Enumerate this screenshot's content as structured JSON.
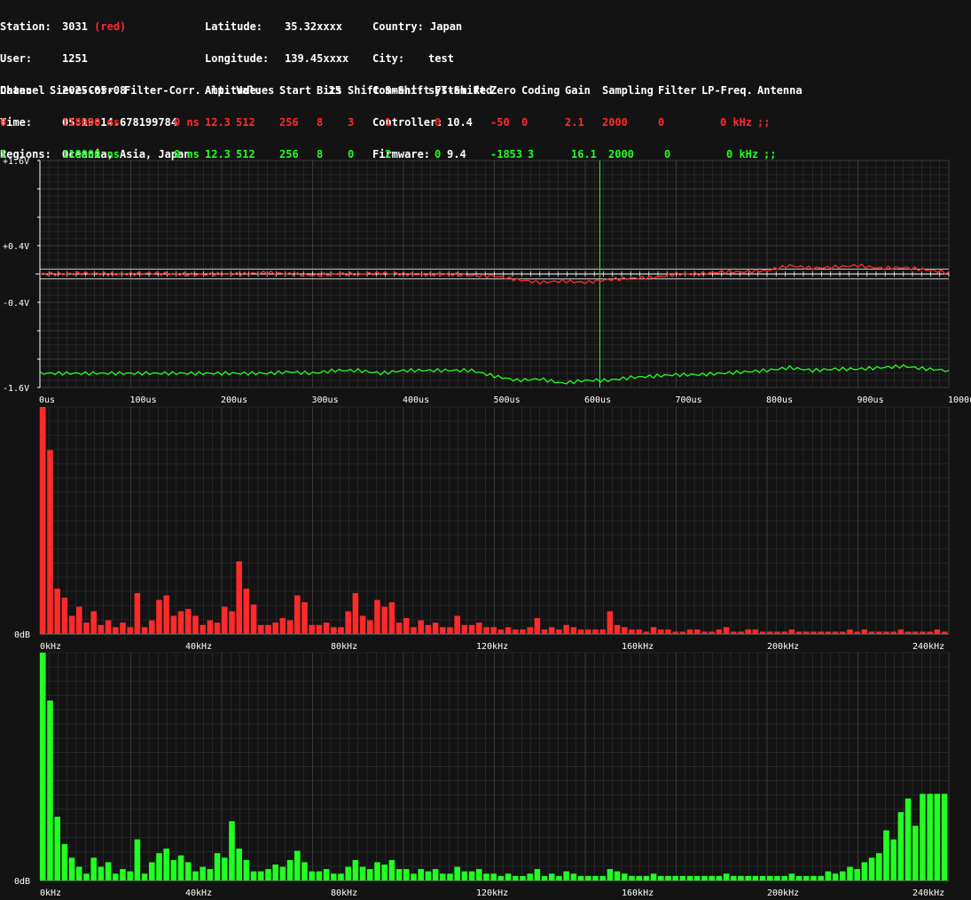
{
  "station": {
    "station_label": "Station:",
    "station_value": "3031",
    "station_tag": "(red)",
    "user_label": "User:",
    "user_value": "1251",
    "date_label": "Date:",
    "date_value": "2025-05-08",
    "time_label": "Time:",
    "time_value": "05:19:14.678199784",
    "regions_label": "Regions:",
    "regions_value": "Oceania, Asia, Japan",
    "lat_label": "Latitude:",
    "lat_value": "35.32xxxx",
    "lon_label": "Longitude:",
    "lon_value": "139.45xxxx",
    "alt_label": "Altitude:",
    "alt_value": "25",
    "country_label": "Country:",
    "country_value": "Japan",
    "city_label": "City:",
    "city_value": "test",
    "comment_label": "Comment:",
    "comment_value": "system Red",
    "controller_label": "Controller:",
    "controller_value": "10.4",
    "firmware_label": "Firmware:",
    "firmware_value": "9.4"
  },
  "channels": {
    "headers": [
      "Channel",
      "Sieve-Corr.",
      "Filter-Corr.",
      "Amp.",
      "Values",
      "Start",
      "Bits",
      "Shift",
      "S-Shift",
      "FT-Shift",
      "Zero",
      "Coding",
      "Gain",
      "Sampling",
      "Filter",
      "LP-Freq.",
      "Antenna"
    ],
    "rows": [
      [
        "0",
        "118000 ns",
        "0 ns",
        "12.3",
        "512",
        "256",
        "8",
        "3",
        "1",
        "0",
        "-50",
        "0",
        "2.1",
        "2000",
        "0",
        "0 kHz",
        ";;"
      ],
      [
        "1",
        "118000 ns",
        "0 ns",
        "12.3",
        "512",
        "256",
        "8",
        "0",
        "2",
        "0",
        "-1853",
        "3",
        "16.1",
        "2000",
        "0",
        "0 kHz",
        ";;"
      ]
    ]
  },
  "colors": {
    "ch0": "#ff2a2a",
    "ch1": "#22ff22",
    "background": "#131313",
    "grid": "#3a3a3a"
  },
  "chart_data": [
    {
      "type": "line",
      "ylabels": [
        "+1.6V",
        "+0.4V",
        "-0.4V",
        "-1.6V"
      ],
      "ytick_values": [
        1.6,
        0.4,
        -0.4,
        -1.6
      ],
      "xlabels": [
        "0us",
        "100us",
        "200us",
        "300us",
        "400us",
        "500us",
        "600us",
        "700us",
        "800us",
        "900us",
        "1000us"
      ],
      "xlim": [
        0,
        1000
      ],
      "ylim": [
        -1.6,
        1.6
      ],
      "cursor_x": 616,
      "grid": true,
      "series": [
        {
          "channel": "0",
          "x": [
            0,
            25,
            50,
            75,
            100,
            125,
            150,
            175,
            200,
            225,
            250,
            275,
            300,
            325,
            350,
            375,
            400,
            425,
            450,
            475,
            500,
            525,
            550,
            575,
            600,
            625,
            650,
            675,
            700,
            725,
            750,
            775,
            800,
            825,
            850,
            875,
            900,
            925,
            950,
            975,
            1000
          ],
          "y": [
            0.0,
            0.0,
            0.01,
            0.0,
            0.0,
            0.01,
            0.0,
            -0.01,
            0.0,
            0.0,
            0.02,
            0.0,
            -0.02,
            0.0,
            0.0,
            0.01,
            0.0,
            -0.01,
            0.0,
            -0.02,
            -0.03,
            -0.08,
            -0.12,
            -0.1,
            -0.12,
            -0.08,
            -0.06,
            -0.05,
            0.0,
            0.0,
            0.03,
            0.03,
            0.05,
            0.12,
            0.08,
            0.1,
            0.12,
            0.08,
            0.09,
            0.06,
            0.02
          ]
        },
        {
          "channel": "1",
          "x": [
            0,
            25,
            50,
            75,
            100,
            125,
            150,
            175,
            200,
            225,
            250,
            275,
            300,
            325,
            350,
            375,
            400,
            425,
            450,
            475,
            500,
            525,
            550,
            575,
            600,
            625,
            650,
            675,
            700,
            725,
            750,
            775,
            800,
            825,
            850,
            875,
            900,
            925,
            950,
            975,
            1000
          ],
          "y": [
            -1.4,
            -1.4,
            -1.4,
            -1.4,
            -1.4,
            -1.4,
            -1.4,
            -1.4,
            -1.4,
            -1.4,
            -1.4,
            -1.38,
            -1.4,
            -1.36,
            -1.36,
            -1.4,
            -1.36,
            -1.36,
            -1.36,
            -1.36,
            -1.44,
            -1.5,
            -1.48,
            -1.54,
            -1.5,
            -1.5,
            -1.46,
            -1.44,
            -1.42,
            -1.42,
            -1.4,
            -1.38,
            -1.36,
            -1.32,
            -1.36,
            -1.34,
            -1.34,
            -1.32,
            -1.3,
            -1.34,
            -1.36
          ]
        }
      ]
    },
    {
      "type": "bar",
      "channel": "0",
      "xlabels": [
        "0kHz",
        "40kHz",
        "80kHz",
        "120kHz",
        "160kHz",
        "200kHz",
        "240kHz"
      ],
      "ylabels": [
        "0dB"
      ],
      "xlim": [
        0,
        250
      ],
      "ylim": [
        0,
        1
      ],
      "values": [
        1.0,
        0.81,
        0.2,
        0.16,
        0.08,
        0.12,
        0.05,
        0.1,
        0.04,
        0.06,
        0.03,
        0.05,
        0.03,
        0.18,
        0.03,
        0.06,
        0.15,
        0.17,
        0.08,
        0.1,
        0.11,
        0.08,
        0.04,
        0.06,
        0.05,
        0.12,
        0.1,
        0.32,
        0.2,
        0.13,
        0.04,
        0.04,
        0.05,
        0.07,
        0.06,
        0.17,
        0.14,
        0.04,
        0.04,
        0.05,
        0.03,
        0.03,
        0.1,
        0.18,
        0.08,
        0.06,
        0.15,
        0.12,
        0.14,
        0.05,
        0.07,
        0.03,
        0.06,
        0.04,
        0.05,
        0.03,
        0.03,
        0.08,
        0.04,
        0.04,
        0.05,
        0.03,
        0.03,
        0.02,
        0.03,
        0.02,
        0.02,
        0.03,
        0.07,
        0.02,
        0.03,
        0.02,
        0.04,
        0.03,
        0.02,
        0.02,
        0.02,
        0.02,
        0.1,
        0.04,
        0.03,
        0.02,
        0.02,
        0.01,
        0.03,
        0.02,
        0.02,
        0.01,
        0.01,
        0.02,
        0.02,
        0.01,
        0.01,
        0.02,
        0.03,
        0.01,
        0.01,
        0.02,
        0.02,
        0.01,
        0.01,
        0.01,
        0.01,
        0.02,
        0.01,
        0.01,
        0.01,
        0.01,
        0.01,
        0.01,
        0.01,
        0.02,
        0.01,
        0.02,
        0.01,
        0.01,
        0.01,
        0.01,
        0.02,
        0.01,
        0.01,
        0.01,
        0.01,
        0.02,
        0.01
      ]
    },
    {
      "type": "bar",
      "channel": "1",
      "xlabels": [
        "0kHz",
        "40kHz",
        "80kHz",
        "120kHz",
        "160kHz",
        "200kHz",
        "240kHz"
      ],
      "ylabels": [
        "0dB"
      ],
      "xlim": [
        0,
        250
      ],
      "ylim": [
        0,
        1
      ],
      "values": [
        1.0,
        0.79,
        0.28,
        0.16,
        0.1,
        0.06,
        0.03,
        0.1,
        0.06,
        0.08,
        0.03,
        0.05,
        0.04,
        0.18,
        0.03,
        0.08,
        0.12,
        0.14,
        0.09,
        0.11,
        0.08,
        0.04,
        0.06,
        0.05,
        0.12,
        0.1,
        0.26,
        0.14,
        0.09,
        0.04,
        0.04,
        0.05,
        0.07,
        0.06,
        0.09,
        0.13,
        0.08,
        0.04,
        0.04,
        0.05,
        0.03,
        0.03,
        0.06,
        0.09,
        0.06,
        0.05,
        0.08,
        0.07,
        0.09,
        0.05,
        0.05,
        0.03,
        0.05,
        0.04,
        0.05,
        0.03,
        0.03,
        0.06,
        0.04,
        0.04,
        0.05,
        0.03,
        0.03,
        0.02,
        0.03,
        0.02,
        0.02,
        0.03,
        0.05,
        0.02,
        0.03,
        0.02,
        0.04,
        0.03,
        0.02,
        0.02,
        0.02,
        0.02,
        0.05,
        0.04,
        0.03,
        0.02,
        0.02,
        0.02,
        0.03,
        0.02,
        0.02,
        0.02,
        0.02,
        0.02,
        0.02,
        0.02,
        0.02,
        0.02,
        0.03,
        0.02,
        0.02,
        0.02,
        0.02,
        0.02,
        0.02,
        0.02,
        0.02,
        0.03,
        0.02,
        0.02,
        0.02,
        0.02,
        0.04,
        0.03,
        0.04,
        0.06,
        0.05,
        0.08,
        0.1,
        0.12,
        0.22,
        0.18,
        0.3,
        0.36,
        0.24,
        0.38,
        0.38,
        0.38,
        0.38
      ]
    }
  ]
}
